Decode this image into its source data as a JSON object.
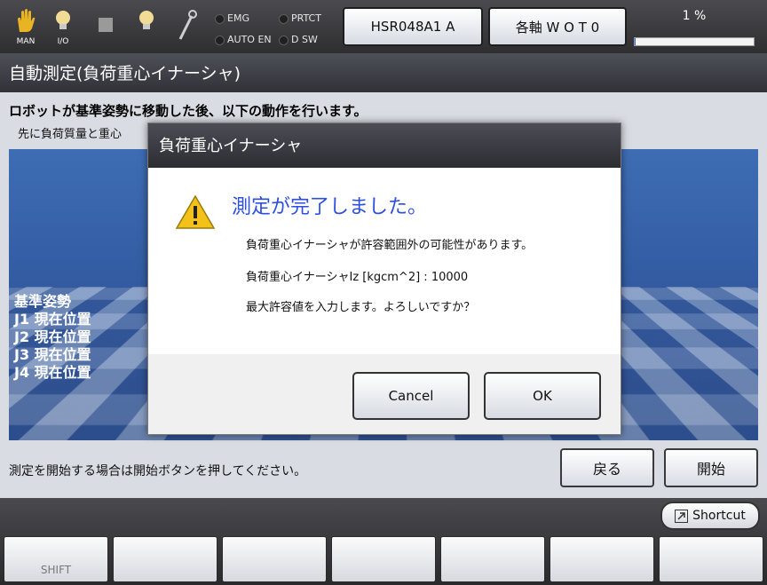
{
  "topbar": {
    "icons": [
      {
        "name": "hand-icon",
        "label": "MAN"
      },
      {
        "name": "lightbulb-icon",
        "label": "I/O"
      },
      {
        "name": "stop-square-icon",
        "label": ""
      },
      {
        "name": "lightbulb-icon",
        "label": ""
      },
      {
        "name": "wrench-icon",
        "label": ""
      }
    ],
    "lamps": {
      "emg": "EMG",
      "prtct": "PRTCT",
      "auto_en": "AUTO EN",
      "dsw": "D SW"
    },
    "robot_button": "HSR048A1 A",
    "mode_button": "各軸 W O T 0",
    "progress_text": "1 %",
    "progress_value": 0.01
  },
  "page_title": "自動測定(負荷重心イナーシャ)",
  "instruction_1": "ロボットが基準姿勢に移動した後、以下の動作を行います。",
  "instruction_2": "先に負荷質量と重心",
  "viewport": {
    "pose_header": "基準姿勢",
    "joints": [
      "J1 現在位置",
      "J2 現在位置",
      "J3 現在位置",
      "J4 現在位置"
    ]
  },
  "status_message": "測定を開始する場合は開始ボタンを押してください。",
  "back_button": "戻る",
  "start_button": "開始",
  "shortcut_button": "Shortcut",
  "function_keys": [
    "SHIFT",
    "",
    "",
    "",
    "",
    "",
    ""
  ],
  "dialog": {
    "title": "負荷重心イナーシャ",
    "heading": "測定が完了しました。",
    "lines": [
      "負荷重心イナーシャが許容範囲外の可能性があります。",
      "負荷重心イナーシャIz [kgcm^2] : 10000",
      "最大許容値を入力します。よろしいですか？"
    ],
    "cancel": "Cancel",
    "ok": "OK"
  },
  "colors": {
    "accent_blue": "#2c4fe0",
    "progress": "#2f6de0",
    "warning": "#f2c21b"
  }
}
